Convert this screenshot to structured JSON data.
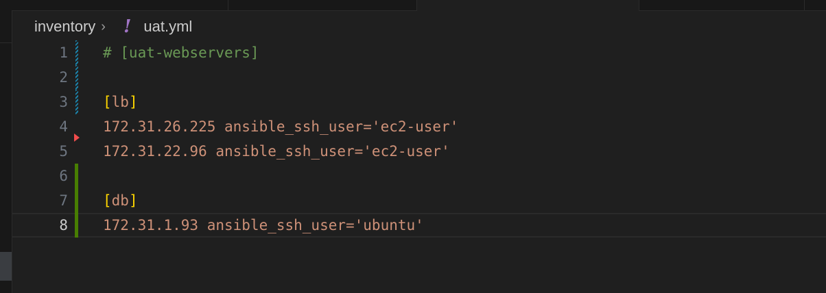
{
  "breadcrumb": {
    "folder": "inventory",
    "file_icon": "!",
    "file": "uat.yml"
  },
  "editor": {
    "lines": [
      {
        "num": "1",
        "text": "# [uat-webservers]"
      },
      {
        "num": "2",
        "text": ""
      },
      {
        "num": "3",
        "open": "[",
        "name": "lb",
        "close": "]"
      },
      {
        "num": "4",
        "text": "172.31.26.225 ansible_ssh_user='ec2-user'"
      },
      {
        "num": "5",
        "text": "172.31.22.96 ansible_ssh_user='ec2-user'"
      },
      {
        "num": "6",
        "text": ""
      },
      {
        "num": "7",
        "open": "[",
        "name": "db",
        "close": "]"
      },
      {
        "num": "8",
        "text": "172.31.1.93 ansible_ssh_user='ubuntu'"
      }
    ],
    "current_line": 8
  },
  "colors": {
    "background": "#1f1f1f",
    "comment": "#6a9955",
    "string": "#ce9178",
    "bracket": "#ffd700",
    "git_modified": "#1b81a8",
    "git_added": "#487e02",
    "git_deleted": "#f14c4c"
  }
}
